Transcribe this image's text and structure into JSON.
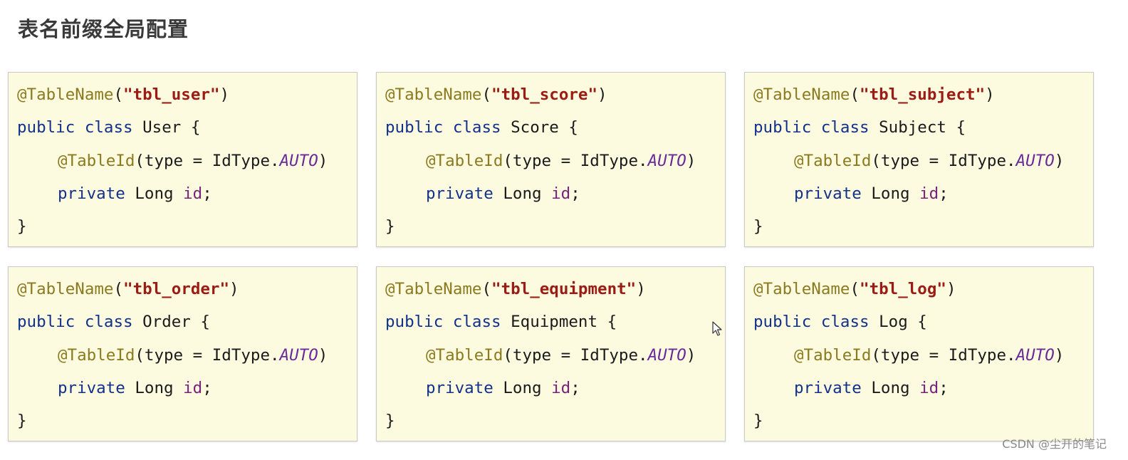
{
  "title": "表名前缀全局配置",
  "code": {
    "annotation_table": "@TableName",
    "paren_open": "(",
    "paren_close": ")",
    "quote": "\"",
    "kw_public_class": "public class",
    "brace_open": " {",
    "annotation_id": "@TableId",
    "id_args_pre": "(type = IdType.",
    "auto": "AUTO",
    "kw_private": "private",
    "type_long": " Long ",
    "field_id": "id",
    "semicolon": ";",
    "brace_close": "}"
  },
  "cards": [
    {
      "table": "tbl_user",
      "class": "User"
    },
    {
      "table": "tbl_score",
      "class": "Score"
    },
    {
      "table": "tbl_subject",
      "class": "Subject"
    },
    {
      "table": "tbl_order",
      "class": "Order"
    },
    {
      "table": "tbl_equipment",
      "class": "Equipment"
    },
    {
      "table": "tbl_log",
      "class": "Log"
    }
  ],
  "watermark": "CSDN @尘开的笔记",
  "colors": {
    "card_background": "#fcfbe0",
    "annotation": "#8b7a1f",
    "string": "#9b1c14",
    "keyword": "#13308a",
    "field": "#7a1f7a"
  },
  "icons": {
    "cursor": "mouse-pointer-icon"
  }
}
